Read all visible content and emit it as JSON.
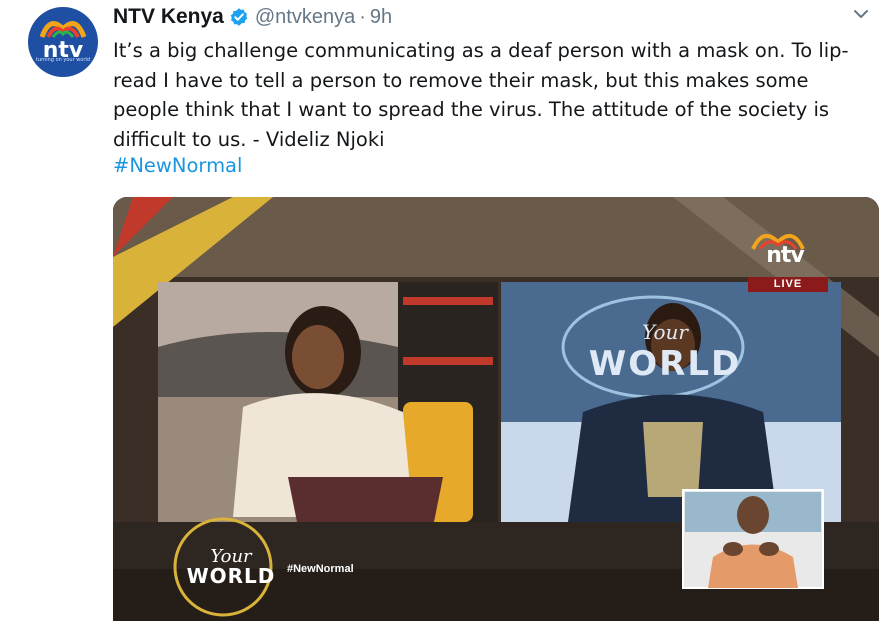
{
  "tweet": {
    "author_name": "NTV Kenya",
    "handle": "@ntvkenya",
    "separator": "·",
    "time": "9h",
    "text": "It’s a big challenge communicating as a deaf person with a mask on. To lip-read I have to tell a person to remove their mask, but this makes some people think that I want to spread the virus. The attitude of the society is difficult to us. - Videliz Njoki",
    "hashtag": "#NewNormal"
  },
  "avatar": {
    "logo_text": "ntv",
    "tagline": "turning on your world"
  },
  "media": {
    "channel_logo": "ntv",
    "live_label": "LIVE",
    "show_your": "Your",
    "show_world": "WORLD",
    "show_hashtag": "#NewNormal"
  },
  "colors": {
    "link": "#1b95e0",
    "verified": "#1da1f2",
    "brand_blue": "#1e4fa3",
    "live_red": "#8b1a1a"
  },
  "icons": {
    "verified": "verified-badge-icon",
    "menu": "chevron-down-icon"
  }
}
